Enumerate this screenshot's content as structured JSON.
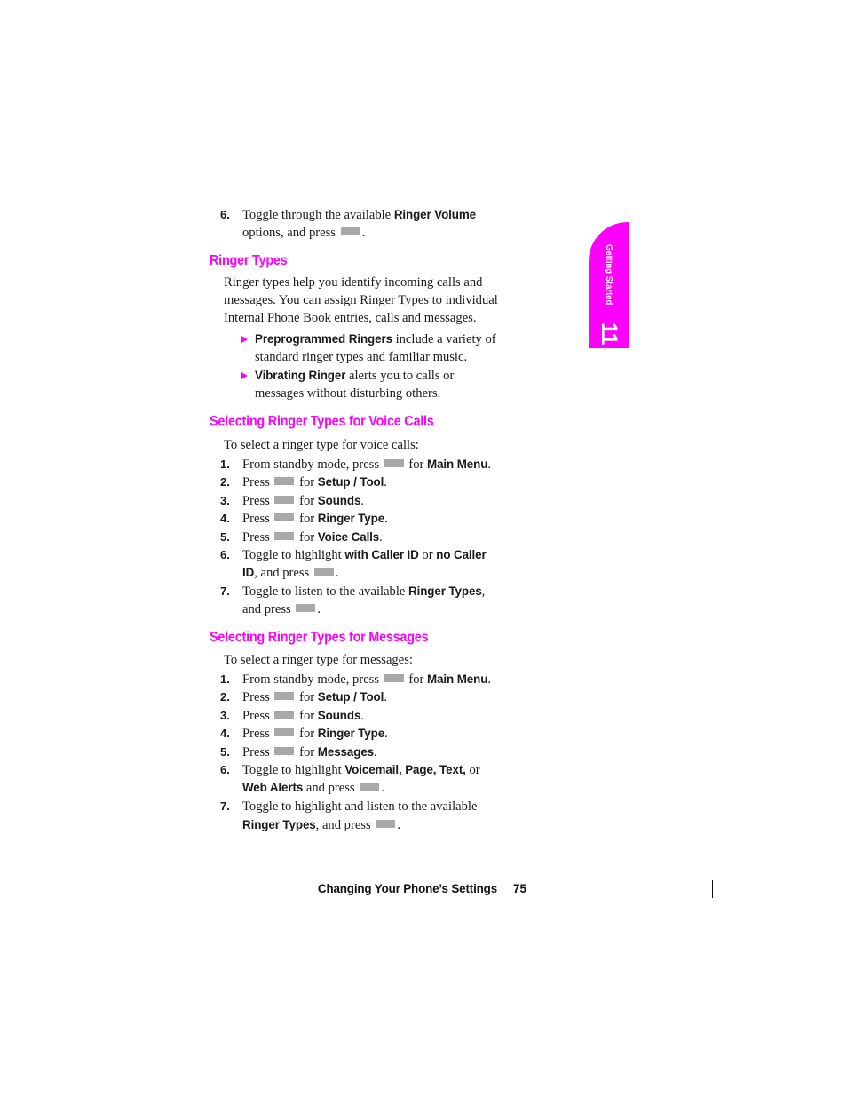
{
  "page": {
    "number": "75",
    "footer_title": "Changing Your Phone’s Settings"
  },
  "thumb_tab": {
    "label": "Getting Started",
    "chapter": "11",
    "color": "#ff00ff"
  },
  "carryover_step": {
    "num": "6.",
    "text_before": "Toggle through the available ",
    "bold_1": "Ringer Volume",
    "text_after": " options, and press ",
    "text_end": "."
  },
  "ringer_types": {
    "heading": "Ringer Types",
    "paragraph": "Ringer types help you identify incoming calls and messages. You can assign Ringer Types to individual Internal Phone Book entries, calls and messages.",
    "bullets": [
      {
        "bold": "Preprogrammed Ringers",
        "rest": " include a variety of standard ringer types and familiar music."
      },
      {
        "bold": "Vibrating Ringer",
        "rest": " alerts you to calls or messages without disturbing others."
      }
    ]
  },
  "voice_calls": {
    "heading": "Selecting Ringer Types for Voice Calls",
    "lead": "To select a ringer type for voice calls:",
    "steps": [
      {
        "num": "1.",
        "pre": "From standby mode, press ",
        "key": true,
        "mid": " for ",
        "bold": "Main Menu",
        "post": "."
      },
      {
        "num": "2.",
        "pre": "Press ",
        "key": true,
        "mid": " for ",
        "bold": "Setup / Tool",
        "post": "."
      },
      {
        "num": "3.",
        "pre": "Press ",
        "key": true,
        "mid": " for ",
        "bold": "Sounds",
        "post": "."
      },
      {
        "num": "4.",
        "pre": "Press ",
        "key": true,
        "mid": " for ",
        "bold": "Ringer Type",
        "post": "."
      },
      {
        "num": "5.",
        "pre": "Press ",
        "key": true,
        "mid": " for ",
        "bold": "Voice Calls",
        "post": "."
      }
    ],
    "step6": {
      "num": "6.",
      "pre": "Toggle to highlight ",
      "bold_1": "with Caller ID",
      "mid": " or ",
      "bold_2": "no Caller ID",
      "post": ", and press ",
      "end": "."
    },
    "step7": {
      "num": "7.",
      "pre": "Toggle to listen to the available ",
      "bold_1": "Ringer Types",
      "post": ", and press ",
      "end": "."
    }
  },
  "messages": {
    "heading": "Selecting Ringer Types for Messages",
    "lead": "To select a ringer type for messages:",
    "steps": [
      {
        "num": "1.",
        "pre": "From standby mode, press ",
        "key": true,
        "mid": " for ",
        "bold": "Main Menu",
        "post": "."
      },
      {
        "num": "2.",
        "pre": "Press ",
        "key": true,
        "mid": " for ",
        "bold": "Setup / Tool",
        "post": "."
      },
      {
        "num": "3.",
        "pre": "Press ",
        "key": true,
        "mid": " for ",
        "bold": "Sounds",
        "post": "."
      },
      {
        "num": "4.",
        "pre": "Press ",
        "key": true,
        "mid": " for ",
        "bold": "Ringer Type",
        "post": "."
      },
      {
        "num": "5.",
        "pre": "Press ",
        "key": true,
        "mid": " for ",
        "bold": "Messages",
        "post": "."
      }
    ],
    "step6": {
      "num": "6.",
      "pre": "Toggle to highlight ",
      "bold_1": "Voicemail, Page, Text,",
      "mid": " or ",
      "bold_2": "Web Alerts",
      "post": " and press ",
      "end": "."
    },
    "step7": {
      "num": "7.",
      "pre": "Toggle to highlight and listen to the available ",
      "bold_1": "Ringer Types",
      "post": ", and press ",
      "end": "."
    }
  }
}
